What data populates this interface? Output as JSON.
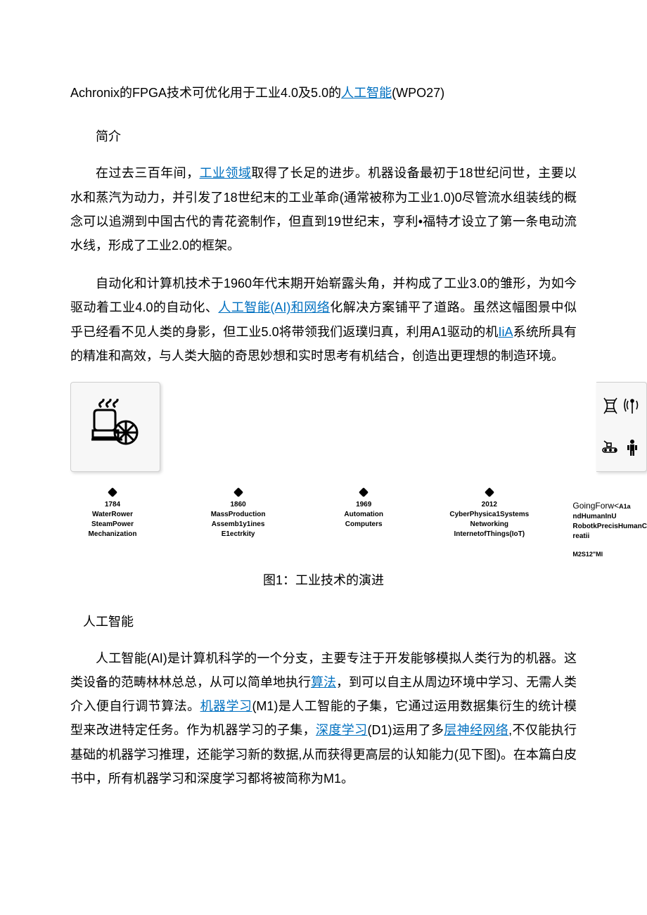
{
  "title_pre": "Achronix的FPGA技术可优化用于工业4.0及5.0的",
  "title_link1": "人工智能",
  "title_post": "(WPO27)",
  "sec1": "简介",
  "p1_pre": "在过去三百年间，",
  "p1_link": "工业领域",
  "p1_post": "取得了长足的进步。机器设备最初于18世纪问世，主要以水和蒸汽为动力，并引发了18世纪末的工业革命(通常被称为工业1.0)0尽管流水组装线的概念可以追溯到中国古代的青花瓷制作，但直到19世纪末，亨利•福特才设立了第一条电动流水线，形成了工业2.0的框架。",
  "p2_a": "自动化和计算机技术于1960年代末期开始崭露头角，并构成了工业3.0的雏形，为如今驱动着工业4.0的自动化、",
  "p2_link1": "人工智能(AI)和网络",
  "p2_b": "化解决方案铺平了道路。虽然这幅图景中似乎已经看不见人类的身影，但工业5.0将带领我们返璞归真，利用A1驱动的机",
  "p2_link2": "IiA",
  "p2_c": "系统所具有的精准和高效，与人类大脑的奇思妙想和实时思考有机结合，创造出更理想的制造环境。",
  "timeline": [
    {
      "year": "1784",
      "l1": "WaterRower",
      "l2": "SteamPower",
      "l3": "Mechanization"
    },
    {
      "year": "1860",
      "l1": "MassProduction",
      "l2": "Assemb1y1ines",
      "l3": "E1ectrkity"
    },
    {
      "year": "1969",
      "l1": "Automation",
      "l2": "Computers",
      "l3": ""
    },
    {
      "year": "2012",
      "l1": "CyberPhysica1Systems",
      "l2": "Networking",
      "l3": "InternetofThings(IoT)"
    }
  ],
  "timeline_last_head": "GoingForw<",
  "timeline_last_h2": "A1a",
  "timeline_last_l1": "ndHumanInU",
  "timeline_last_l2": "RobotkPrecisHumanC",
  "timeline_last_l3": "reatii",
  "timeline_last_m2": "M2S12\"MI",
  "fig_caption": "图1：工业技术的演进",
  "sec2": "人工智能",
  "p3_a": "人工智能(AI)是计算机科学的一个分支，主要专注于开发能够模拟人类行为的机器。这类设备的范畴林林总总，从可以简单地执行",
  "p3_link1": "算法",
  "p3_b": "，到可以自主从周边环境中学习、无需人类介入便自行调节算法。",
  "p3_link2": "机器学习",
  "p3_c": "(M1)是人工智能的子集，它通过运用数据集衍生的统计模型来改进特定任务。作为机器学习的子集，",
  "p3_link3": "深度学习",
  "p3_d": "(D1)运用了多",
  "p3_link4": "层神经网络",
  "p3_e": ",不仅能执行基础的机器学习推理，还能学习新的数据,从而获得更高层的认知能力(见下图)。在本篇白皮书中，所有机器学习和深度学习都将被简称为M1。"
}
